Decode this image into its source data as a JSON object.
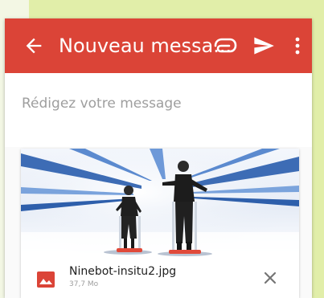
{
  "window": {
    "background": "#f3f7e4",
    "accent_panel": "#e1eea9"
  },
  "appbar": {
    "title": "Nouveau messa...",
    "color": "#db4437",
    "icons": {
      "back": "arrow-back-icon",
      "attach": "paperclip-icon",
      "send": "send-icon",
      "more": "more-vertical-icon"
    }
  },
  "compose": {
    "placeholder": "Rédigez votre message"
  },
  "attachment": {
    "image_description": "two people riding self-balancing scooters in a bright white futuristic hall",
    "file_name": "Ninebot-insitu2.jpg",
    "file_size": "37,7 Mo",
    "file_icon": "image-file-icon",
    "file_icon_color": "#db4437",
    "remove_icon": "close-icon"
  }
}
